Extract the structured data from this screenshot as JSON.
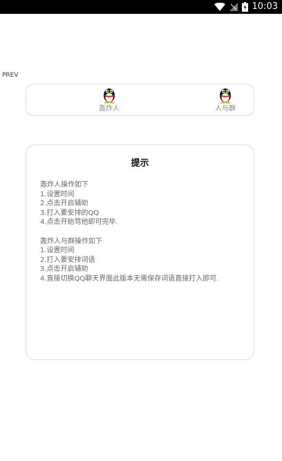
{
  "status_bar": {
    "time": "10:03",
    "icons": [
      "wifi-icon",
      "signal-icon",
      "battery-icon"
    ]
  },
  "prev_label": "PREV",
  "tools": [
    {
      "label": "轰炸人",
      "icon": "qq-penguin-icon"
    },
    {
      "label": "人与群",
      "icon": "qq-penguin-icon"
    }
  ],
  "tips": {
    "title": "提示",
    "section1": {
      "heading": "轰炸人操作如下",
      "steps": [
        "1.设置时间",
        "2.点击开启辅助",
        "3.打入要安排的QQ",
        "4.点击开始骂他即可完毕."
      ]
    },
    "section2": {
      "heading": "轰炸人与群操作如下",
      "steps": [
        "1.设置时间",
        "2.打入要安排词语",
        "3.点击开启辅助",
        "4.直接切换QQ聊天界面此版本无需保存词语直接打入即可."
      ]
    }
  }
}
